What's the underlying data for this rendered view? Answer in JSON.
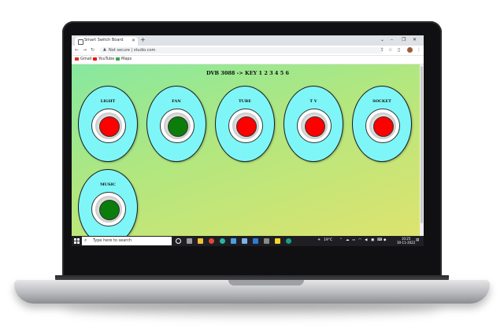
{
  "browser": {
    "tab_title": "Smart Switch Board",
    "url": "studio.com",
    "security_label": "Not secure",
    "bookmarks": [
      "Gmail",
      "YouTube",
      "Maps"
    ]
  },
  "page": {
    "title": "DVB 3088 -> KEY 1 2 3 4 5 6",
    "switches": [
      {
        "label": "LIGHT",
        "state": "off",
        "color": "#ff0000"
      },
      {
        "label": "FAN",
        "state": "on",
        "color": "#0a7d0a"
      },
      {
        "label": "TUBE",
        "state": "off",
        "color": "#ff0000"
      },
      {
        "label": "T V",
        "state": "off",
        "color": "#ff0000"
      },
      {
        "label": "SOCKET",
        "state": "off",
        "color": "#ff0000"
      },
      {
        "label": "MUSIC",
        "state": "on",
        "color": "#0a7d0a"
      }
    ]
  },
  "taskbar": {
    "search_placeholder": "Type here to search",
    "weather": "19°C",
    "time": "10:25",
    "date": "30-11-2022"
  }
}
